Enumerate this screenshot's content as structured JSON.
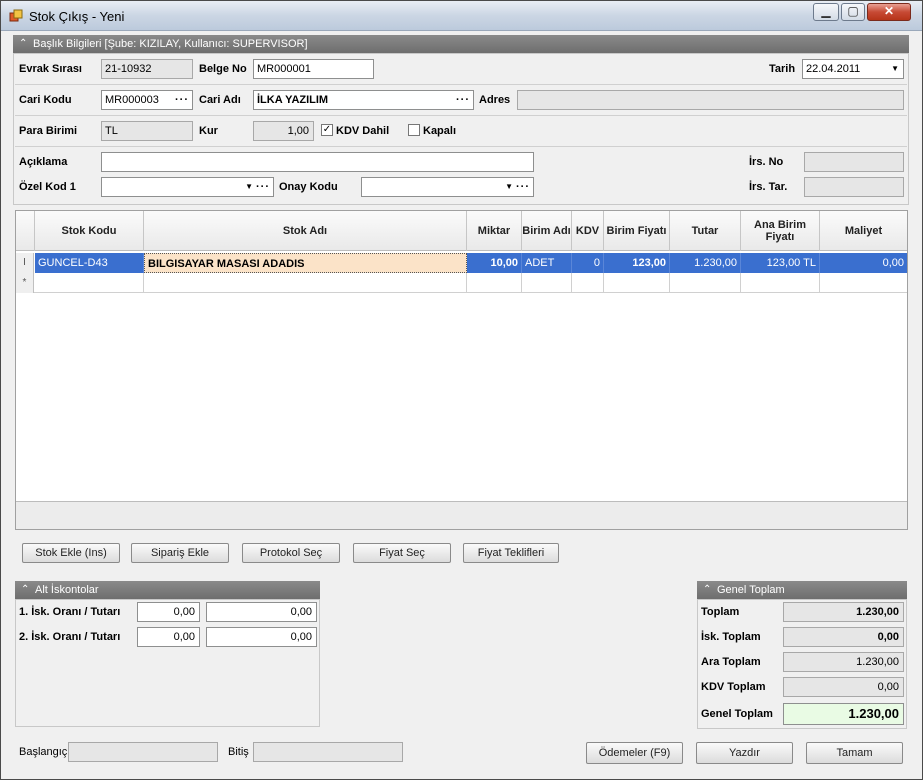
{
  "window": {
    "title": "Stok Çıkış - Yeni",
    "minimize": "▁",
    "maximize": "▢",
    "close": "✕"
  },
  "header_panel": {
    "title": "Başlık Bilgileri [Şube: KIZILAY, Kullanıcı: SUPERVISOR]"
  },
  "fields": {
    "evrak_sirasi_label": "Evrak Sırası",
    "evrak_sirasi": "21-10932",
    "belge_no_label": "Belge No",
    "belge_no": "MR000001",
    "tarih_label": "Tarih",
    "tarih": "22.04.2011",
    "cari_kodu_label": "Cari Kodu",
    "cari_kodu": "MR000003",
    "cari_adi_label": "Cari Adı",
    "cari_adi": "İLKA YAZILIM",
    "adres_label": "Adres",
    "adres": "",
    "para_birimi_label": "Para Birimi",
    "para_birimi": "TL",
    "kur_label": "Kur",
    "kur": "1,00",
    "kdv_dahil_label": "KDV Dahil",
    "kdv_dahil_checked": true,
    "kapali_label": "Kapalı",
    "kapali_checked": false,
    "aciklama_label": "Açıklama",
    "aciklama": "",
    "ozel_kod_label": "Özel Kod 1",
    "ozel_kod": "",
    "onay_kodu_label": "Onay Kodu",
    "onay_kodu": "",
    "irs_no_label": "İrs. No",
    "irs_no": "",
    "irs_tar_label": "İrs. Tar.",
    "irs_tar": ""
  },
  "grid": {
    "columns": [
      "Stok Kodu",
      "Stok Adı",
      "Miktar",
      "Birim Adı",
      "KDV",
      "Birim Fiyatı",
      "Tutar",
      "Ana Birim Fiyatı",
      "Maliyet"
    ],
    "rows": [
      {
        "stok_kodu": "GUNCEL-D43",
        "stok_adi": "BILGISAYAR MASASI ADADIS",
        "miktar": "10,00",
        "birim": "ADET",
        "kdv": "0",
        "birim_fiyati": "123,00",
        "tutar": "1.230,00",
        "ana_birim_fiyati": "123,00 TL",
        "maliyet": "0,00"
      }
    ],
    "edit_marker": "I",
    "new_marker": "*"
  },
  "actions": [
    "Stok Ekle (Ins)",
    "Sipariş Ekle",
    "Protokol Seç",
    "Fiyat Seç",
    "Fiyat Teklifleri"
  ],
  "discounts": {
    "title": "Alt İskontolar",
    "rows": [
      {
        "label": "1. İsk. Oranı / Tutarı",
        "oran": "0,00",
        "tutar": "0,00"
      },
      {
        "label": "2. İsk. Oranı / Tutarı",
        "oran": "0,00",
        "tutar": "0,00"
      }
    ]
  },
  "totals": {
    "title": "Genel Toplam",
    "toplam_label": "Toplam",
    "toplam": "1.230,00",
    "isk_label": "İsk. Toplam",
    "isk": "0,00",
    "ara_label": "Ara Toplam",
    "ara": "1.230,00",
    "kdv_label": "KDV Toplam",
    "kdv": "0,00",
    "genel_label": "Genel Toplam",
    "genel": "1.230,00"
  },
  "footer": {
    "baslangic_label": "Başlangıç",
    "baslangic": "",
    "bitis_label": "Bitiş",
    "bitis": "",
    "odemeler": "Ödemeler (F9)",
    "yazdir": "Yazdır",
    "tamam": "Tamam"
  }
}
